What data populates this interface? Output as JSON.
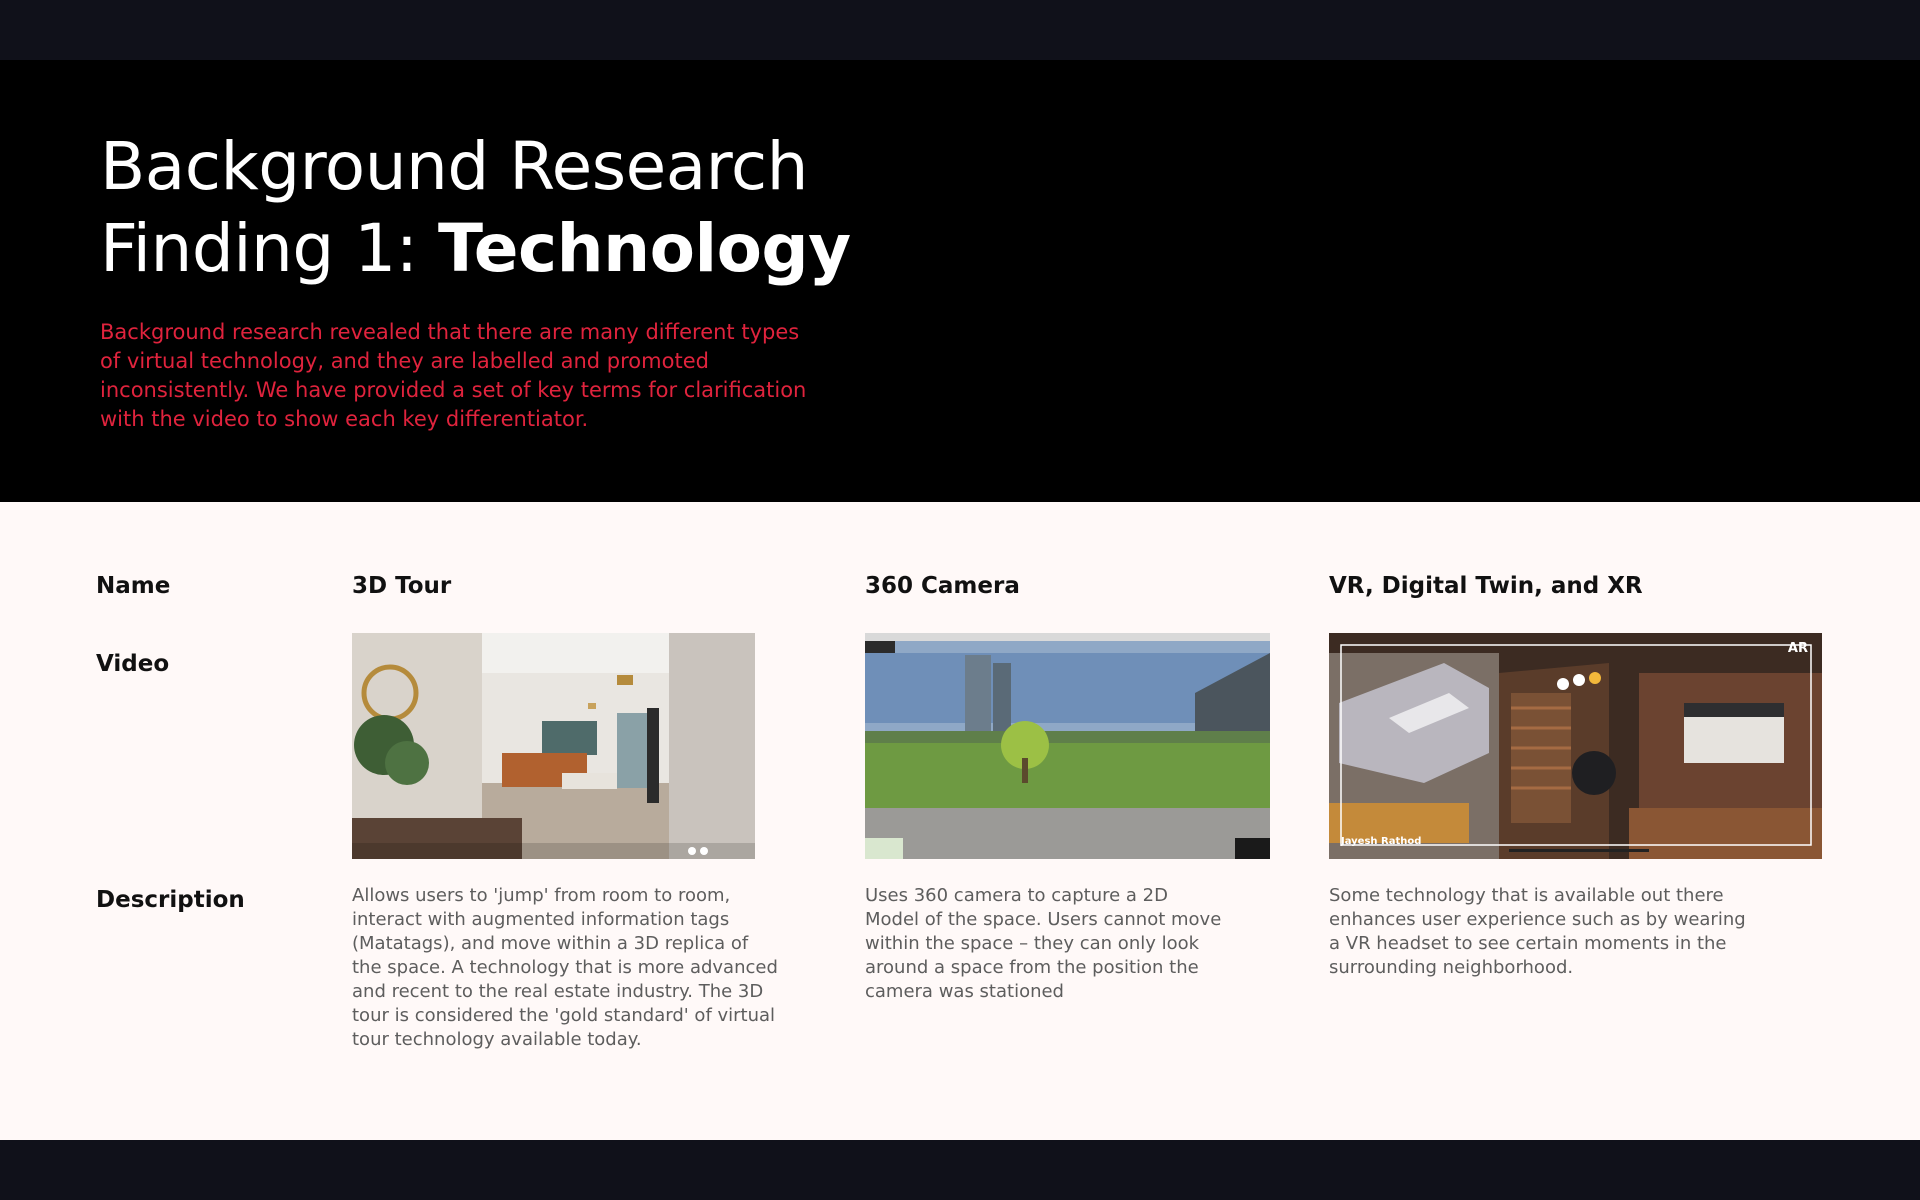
{
  "hero": {
    "title_line1": "Background Research",
    "title_line2_regular": "Finding 1: ",
    "title_line2_bold": "Technology",
    "description": "Background research revealed that there are many different types of virtual technology, and they are labelled and promoted inconsistently. We have provided a set of key terms for clarification with the video to show each key differentiator."
  },
  "table": {
    "row_labels": {
      "name": "Name",
      "video": "Video",
      "description": "Description"
    },
    "columns": [
      {
        "name": "3D Tour",
        "description": "Allows users to 'jump' from room to room, interact with augmented information tags (Matatags), and move within a 3D replica of the space. A technology that is more advanced and recent to the real estate industry. The 3D tour is considered the 'gold standard' of virtual tour technology available today."
      },
      {
        "name": "360 Camera",
        "description": "Uses 360 camera to capture a 2D Model of the space. Users cannot move within the space – they can only look around a space from the position the camera was stationed"
      },
      {
        "name": "VR, Digital Twin, and XR",
        "description": "Some technology that is available out there enhances user experience such as by wearing a VR headset to see certain moments in the surrounding neighborhood.",
        "video_overlay_tag": "AR",
        "video_overlay_credit": "Jayesh Rathod"
      }
    ]
  },
  "colors": {
    "hero_background": "#000000",
    "content_background": "#fff9f8",
    "accent_red": "#e0233d",
    "frame_dark": "#10111a"
  }
}
